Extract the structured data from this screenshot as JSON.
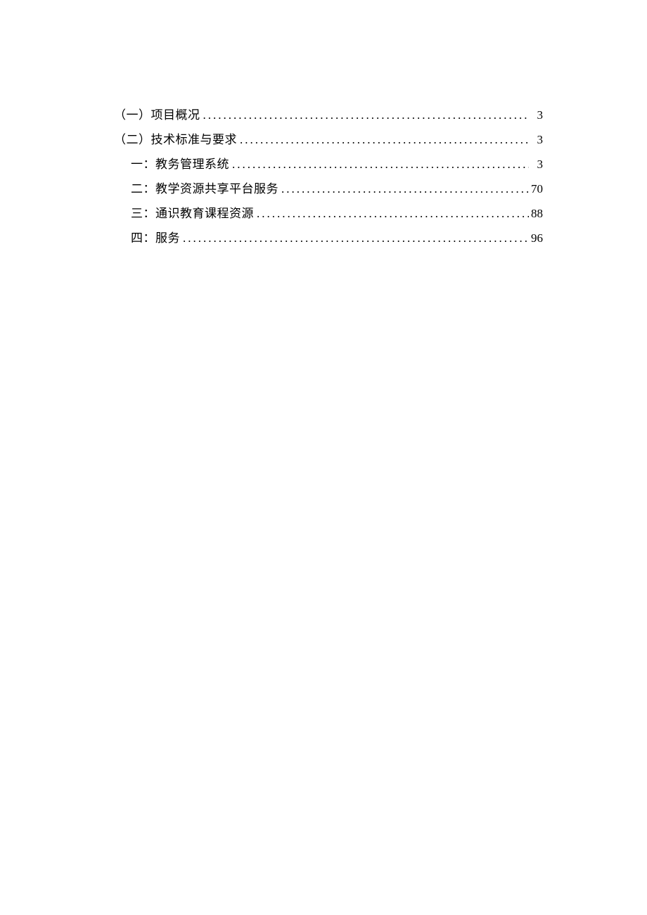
{
  "toc": {
    "entries": [
      {
        "level": 1,
        "title": "（一）项目概况",
        "page": "3"
      },
      {
        "level": 1,
        "title": "（二）技术标准与要求",
        "page": "3"
      },
      {
        "level": 2,
        "title": "一：教务管理系统",
        "page": "3"
      },
      {
        "level": 2,
        "title": "二：教学资源共享平台服务",
        "page": "70"
      },
      {
        "level": 2,
        "title": "三：通识教育课程资源",
        "page": "88"
      },
      {
        "level": 2,
        "title": "四：服务",
        "page": "96"
      }
    ]
  }
}
